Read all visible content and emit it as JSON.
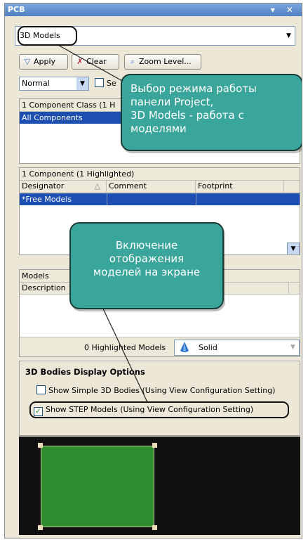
{
  "window": {
    "title": "PCB",
    "controls": "▾ ✕"
  },
  "mode_select": {
    "value": "3D Models"
  },
  "toolbar": {
    "apply_label": "Apply",
    "clear_label": "Clear",
    "zoom_label": "Zoom Level..."
  },
  "filter": {
    "mode_value": "Normal",
    "select_partial": "Se"
  },
  "class_panel": {
    "header": "1 Component Class (1 H",
    "row": "All Components"
  },
  "component_panel": {
    "header": "1 Component (1 Highlighted)",
    "columns": [
      "Designator",
      "Comment",
      "Footprint"
    ],
    "row": "*Free Models"
  },
  "models_panel": {
    "header": "Models",
    "column": "Description"
  },
  "highlight_bar": {
    "count_text": "0 Highlighted Models",
    "render_value": "Solid"
  },
  "display_options": {
    "title": "3D Bodies Display Options",
    "simple_label": "Show Simple 3D Bodies (Using View Configuration Setting)",
    "step_label": "Show STEP Models (Using View Configuration Setting)",
    "simple_checked": false,
    "step_checked": true
  },
  "callouts": {
    "mode": "Выбор режима работы\nпанели Project,\n3D Models - работа с\nмоделями",
    "display": "Включение\nотображения\nмоделей на экране"
  },
  "colors": {
    "accent": "#1c4fb1",
    "callout": "#3aa59b",
    "preview_board": "#2e8b2e",
    "preview_bg": "#101010"
  }
}
